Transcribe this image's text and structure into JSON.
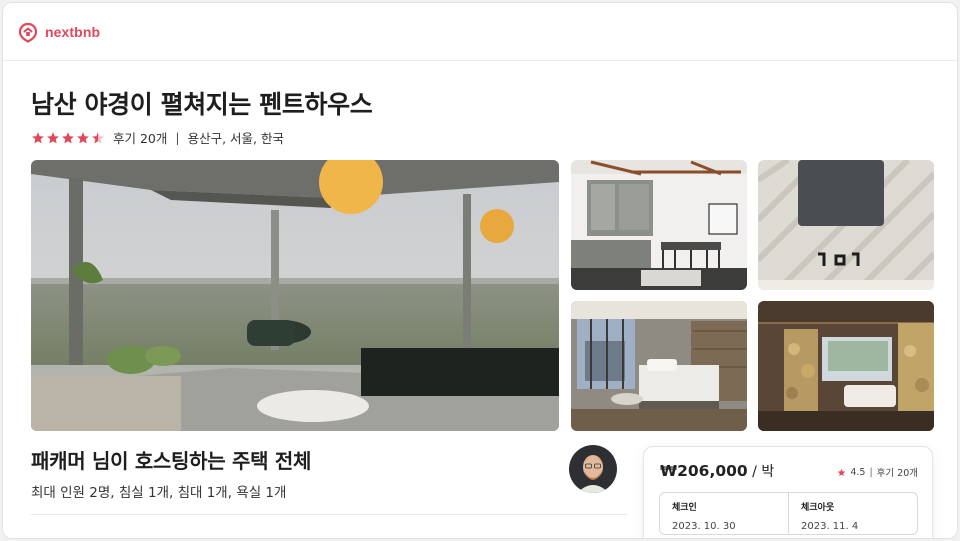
{
  "brand": {
    "name": "nextbnb",
    "color": "#e0475a"
  },
  "listing": {
    "title": "남산 야경이 펼쳐지는 펜트하우스",
    "rating_stars": 4.5,
    "reviews": "후기 20개",
    "location": "용산구, 서울, 한국"
  },
  "gallery": {
    "photos": [
      "living-room-panorama",
      "kitchen-dining",
      "bathroom-sink",
      "bedroom-city-view",
      "stone-bathroom-tub"
    ]
  },
  "host": {
    "title": "패캐머 님이 호스팅하는 주택 전체",
    "details": "최대 인원 2명, 침실 1개, 침대 1개, 욕실 1개"
  },
  "booking": {
    "price": "₩206,000",
    "per": " / 박",
    "rating": "4.5",
    "reviews": "후기 20개",
    "checkin_label": "체크인",
    "checkin_value": "2023. 10. 30",
    "checkout_label": "체크아웃",
    "checkout_value": "2023. 11. 4"
  },
  "colors": {
    "star": "#e0475a",
    "accent": "#e0475a"
  }
}
